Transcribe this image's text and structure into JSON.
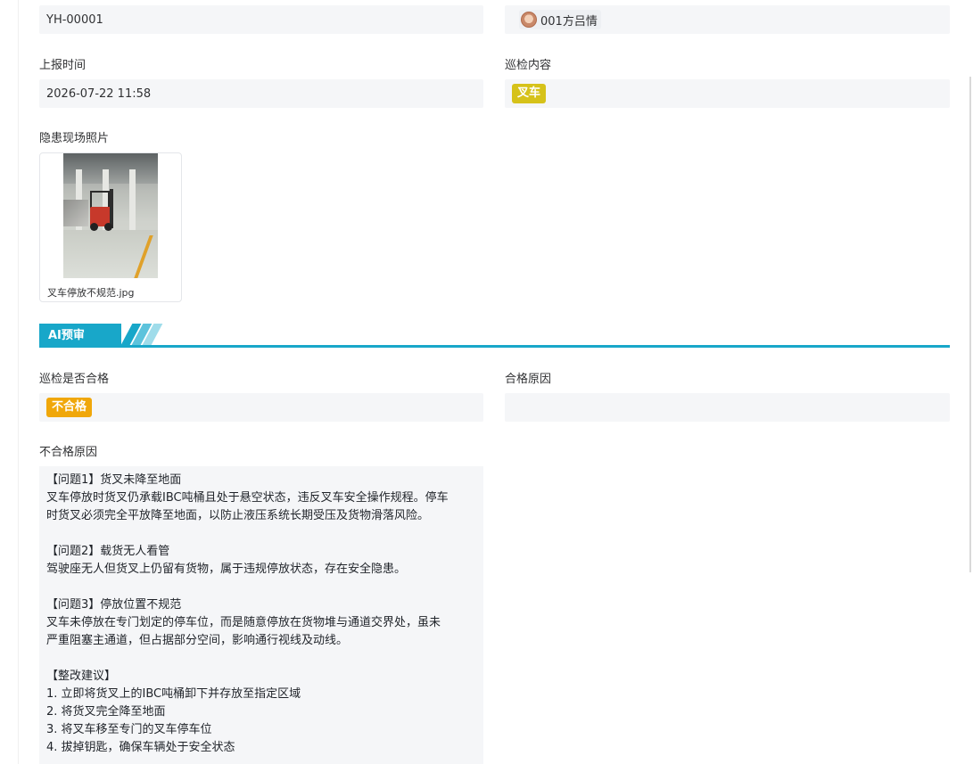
{
  "form": {
    "code_value": "YH-00001",
    "reporter": "001方吕情",
    "report_time_label": "上报时间",
    "report_time_value": "2026-07-22 11:58",
    "inspect_content_label": "巡检内容",
    "inspect_content_tag": "叉车",
    "photo_label": "隐患现场照片",
    "photo_filename": "叉车停放不规范.jpg"
  },
  "ai_section": {
    "title": "AI预审",
    "pass_label": "巡检是否合格",
    "pass_value": "不合格",
    "pass_reason_label": "合格原因",
    "pass_reason_value": "",
    "fail_reason_label": "不合格原因",
    "fail_reason_lines": [
      "【问题1】货叉未降至地面",
      "叉车停放时货叉仍承载IBC吨桶且处于悬空状态，违反叉车安全操作规程。停车",
      "时货叉必须完全平放降至地面，以防止液压系统长期受压及货物滑落风险。",
      "",
      "【问题2】载货无人看管",
      "驾驶座无人但货叉上仍留有货物，属于违规停放状态，存在安全隐患。",
      "",
      "【问题3】停放位置不规范",
      "叉车未停放在专门划定的停车位，而是随意停放在货物堆与通道交界处，虽未",
      "严重阻塞主通道，但占据部分空间，影响通行视线及动线。",
      "",
      "【整改建议】",
      "1. 立即将货叉上的IBC吨桶卸下并存放至指定区域",
      "2. 将货叉完全降至地面",
      "3. 将叉车移至专门的叉车停车位",
      "4. 拔掉钥匙，确保车辆处于安全状态"
    ]
  },
  "colors": {
    "accent": "#18a7c9",
    "tag_forklift": "#d6c21a",
    "tag_fail": "#f0a70a",
    "field_bg": "#f5f6f8"
  }
}
